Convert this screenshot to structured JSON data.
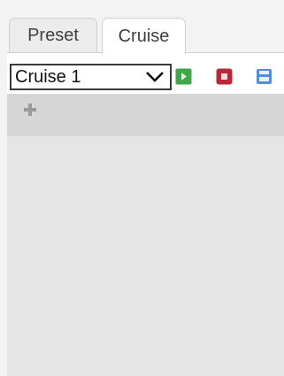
{
  "tabs": [
    {
      "label": "Preset",
      "active": false
    },
    {
      "label": "Cruise",
      "active": true
    }
  ],
  "toolbar": {
    "cruise_select_value": "Cruise 1",
    "icons": {
      "dropdown": "chevron-down-icon",
      "play": "play-icon",
      "stop": "stop-icon",
      "save": "save-icon"
    }
  },
  "add_bar": {
    "icon": "plus-icon"
  },
  "colors": {
    "play_green": "#3fa64a",
    "stop_red": "#b8283a",
    "save_blue": "#4f8fd8",
    "plus_gray": "#9a9a9a"
  },
  "cruise_list": []
}
